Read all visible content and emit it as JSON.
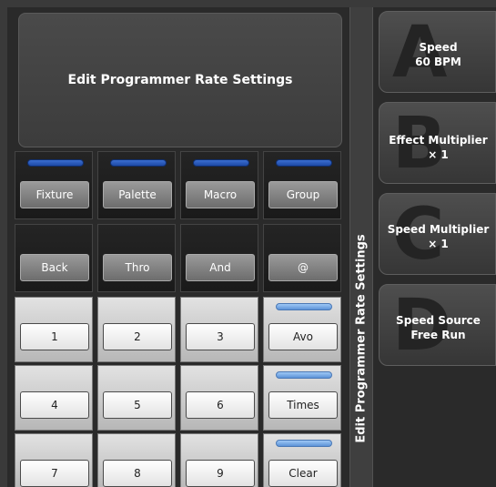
{
  "header": {
    "title": "Edit Programmer Rate Settings"
  },
  "side_label": "Edit Programmer Rate Settings",
  "top_row": [
    "Fixture",
    "Palette",
    "Macro",
    "Group"
  ],
  "second_row": [
    "Back",
    "Thro",
    "And",
    "@"
  ],
  "number_rows": [
    [
      "1",
      "2",
      "3",
      "Avo"
    ],
    [
      "4",
      "5",
      "6",
      "Times"
    ],
    [
      "7",
      "8",
      "9",
      "Clear"
    ]
  ],
  "softkeys": [
    {
      "letter": "A",
      "line1": "Speed",
      "line2": "60 BPM"
    },
    {
      "letter": "B",
      "line1": "Effect Multiplier",
      "line2": "× 1"
    },
    {
      "letter": "C",
      "line1": "Speed Multiplier",
      "line2": "× 1"
    },
    {
      "letter": "D",
      "line1": "Speed Source",
      "line2": "Free Run"
    }
  ],
  "colors": {
    "background": "#2a2a2a",
    "led_blue": "#3b6ed0",
    "led_light": "#6fb3ea"
  }
}
